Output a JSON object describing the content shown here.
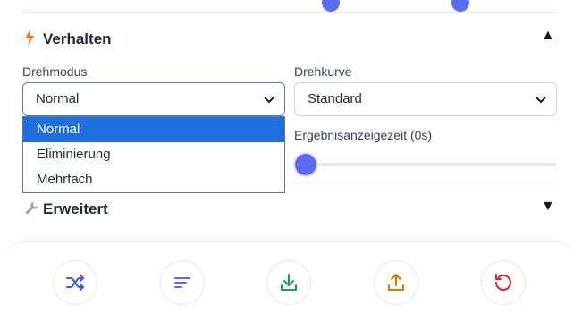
{
  "sections": {
    "behavior": {
      "title": "Verhalten",
      "icon": "lightning-icon",
      "expanded": true
    },
    "advanced": {
      "title": "Erweitert",
      "icon": "wrench-icon",
      "expanded": false
    }
  },
  "fields": {
    "spin_mode": {
      "label": "Drehmodus",
      "value": "Normal",
      "options": [
        "Normal",
        "Eliminierung",
        "Mehrfach"
      ]
    },
    "spin_curve": {
      "label": "Drehkurve",
      "value": "Standard"
    },
    "result_display_time": {
      "label": "Ergebnisanzeigezeit (0s)",
      "value": 0
    }
  },
  "toolbar": {
    "buttons": [
      {
        "icon": "shuffle-icon",
        "color": "#3b5bdb"
      },
      {
        "icon": "sort-icon",
        "color": "#7c5cf0"
      },
      {
        "icon": "download-icon",
        "color": "#16a34a"
      },
      {
        "icon": "upload-icon",
        "color": "#d97706"
      },
      {
        "icon": "reset-icon",
        "color": "#dc2626"
      }
    ]
  },
  "colors": {
    "accent": "#5b6cf2",
    "selected_option": "#1f6fde"
  }
}
